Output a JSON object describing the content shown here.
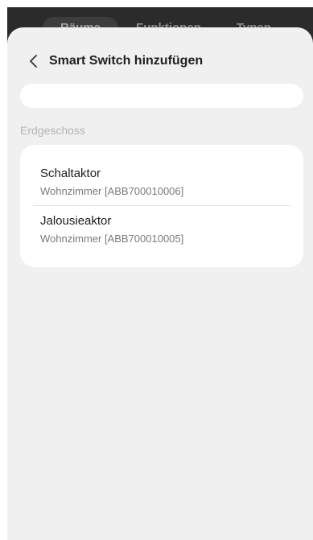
{
  "background_tabs": [
    "Räume",
    "Funktionen",
    "Typen"
  ],
  "header": {
    "title": "Smart Switch hinzufügen",
    "back_icon": "chevron-left-icon"
  },
  "search": {
    "value": "",
    "placeholder": ""
  },
  "section": {
    "label": "Erdgeschoss",
    "devices": [
      {
        "name": "Schaltaktor",
        "detail": "Wohnzimmer [ABB700010006]"
      },
      {
        "name": "Jalousieaktor",
        "detail": "Wohnzimmer [ABB700010005]"
      }
    ]
  },
  "colors": {
    "sheet": "#f0f0f0",
    "card": "#ffffff",
    "overlay": "#2b2b2b"
  }
}
